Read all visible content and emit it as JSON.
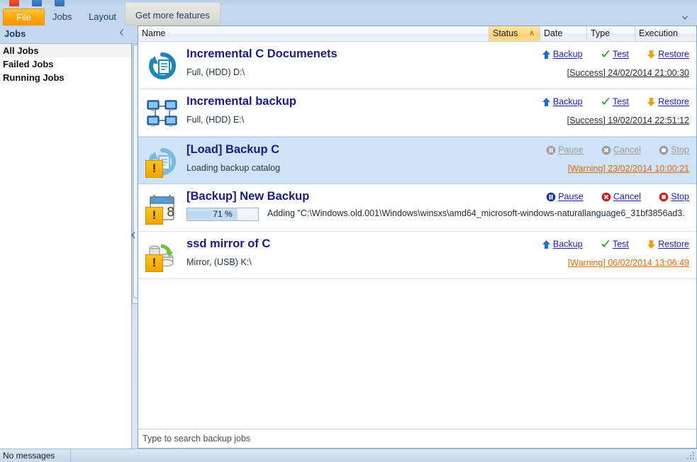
{
  "window": {
    "ribbon_expand_icon": "chevron-down-icon",
    "quick_access_icons": [
      "record-icon",
      "save-icon",
      "open-icon"
    ]
  },
  "tabs": [
    {
      "label": "File",
      "active": true
    },
    {
      "label": "Jobs",
      "active": false
    },
    {
      "label": "Layout",
      "active": false
    },
    {
      "label": "Get more features",
      "active": false
    }
  ],
  "sidebar": {
    "title": "Jobs",
    "collapse_icon": "chevron-left-icon",
    "items": [
      {
        "label": "All Jobs",
        "selected": true
      },
      {
        "label": "Failed Jobs",
        "selected": false
      },
      {
        "label": "Running Jobs",
        "selected": false
      }
    ]
  },
  "columns": {
    "name": "Name",
    "status": "Status",
    "status_sort": "∧",
    "date": "Date",
    "type": "Type",
    "execution_order": "Execution Order"
  },
  "jobs": [
    {
      "title": "Incremental C Documenets",
      "subtitle": "Full, (HDD) D:\\",
      "icon": "restore-document-icon",
      "warning_badge": false,
      "selected": false,
      "actions": [
        {
          "label": "Backup",
          "icon": "arrow-up-icon",
          "disabled": false
        },
        {
          "label": "Test",
          "icon": "check-icon",
          "disabled": false
        },
        {
          "label": "Restore",
          "icon": "arrow-down-icon",
          "disabled": false
        }
      ],
      "status_text": "[Success] 24/02/2014 21:00:30",
      "status_kind": "success"
    },
    {
      "title": "Incremental backup",
      "subtitle": "Full, (HDD) E:\\",
      "icon": "network-computers-icon",
      "warning_badge": false,
      "selected": false,
      "actions": [
        {
          "label": "Backup",
          "icon": "arrow-up-icon",
          "disabled": false
        },
        {
          "label": "Test",
          "icon": "check-icon",
          "disabled": false
        },
        {
          "label": "Restore",
          "icon": "arrow-down-icon",
          "disabled": false
        }
      ],
      "status_text": "[Success] 19/02/2014 22:51:12",
      "status_kind": "success"
    },
    {
      "title": "[Load] Backup C",
      "subtitle": "Loading backup catalog",
      "icon": "restore-document-icon-faded",
      "warning_badge": true,
      "selected": true,
      "actions": [
        {
          "label": "Pause",
          "icon": "pause-icon",
          "disabled": true
        },
        {
          "label": "Cancel",
          "icon": "cancel-icon",
          "disabled": true
        },
        {
          "label": "Stop",
          "icon": "stop-icon",
          "disabled": true
        }
      ],
      "status_text": "[Warning] 23/02/2014 10:00:21",
      "status_kind": "warning"
    },
    {
      "title": "[Backup] New Backup",
      "icon": "calendar-icon",
      "warning_badge": true,
      "selected": false,
      "progress_percent": 71,
      "progress_label": "71 %",
      "progress_message": "Adding \"C:\\Windows.old.001\\Windows\\winsxs\\amd64_microsoft-windows-naturallanguage6_31bf3856ad3...",
      "actions": [
        {
          "label": "Pause",
          "icon": "pause-icon",
          "disabled": false
        },
        {
          "label": "Cancel",
          "icon": "cancel-icon",
          "disabled": false
        },
        {
          "label": "Stop",
          "icon": "stop-icon",
          "disabled": false
        }
      ]
    },
    {
      "title": "ssd mirror of C",
      "subtitle": "Mirror, (USB) K:\\",
      "icon": "disk-mirror-icon",
      "warning_badge": true,
      "selected": false,
      "actions": [
        {
          "label": "Backup",
          "icon": "arrow-up-icon",
          "disabled": false
        },
        {
          "label": "Test",
          "icon": "check-icon",
          "disabled": false
        },
        {
          "label": "Restore",
          "icon": "arrow-down-icon",
          "disabled": false
        }
      ],
      "status_text": "[Warning] 06/02/2014 13:06:49",
      "status_kind": "warning"
    }
  ],
  "search": {
    "value": "",
    "placeholder": "Type to search backup jobs"
  },
  "statusbar": {
    "message": "No messages"
  },
  "colors": {
    "accent_orange": "#ffa408",
    "link_blue": "#1a1acc",
    "title_blue": "#1a1a8c",
    "warning_orange": "#e06a00",
    "selection_blue": "#cfe3f7",
    "status_column_highlight": "#ffd884"
  }
}
